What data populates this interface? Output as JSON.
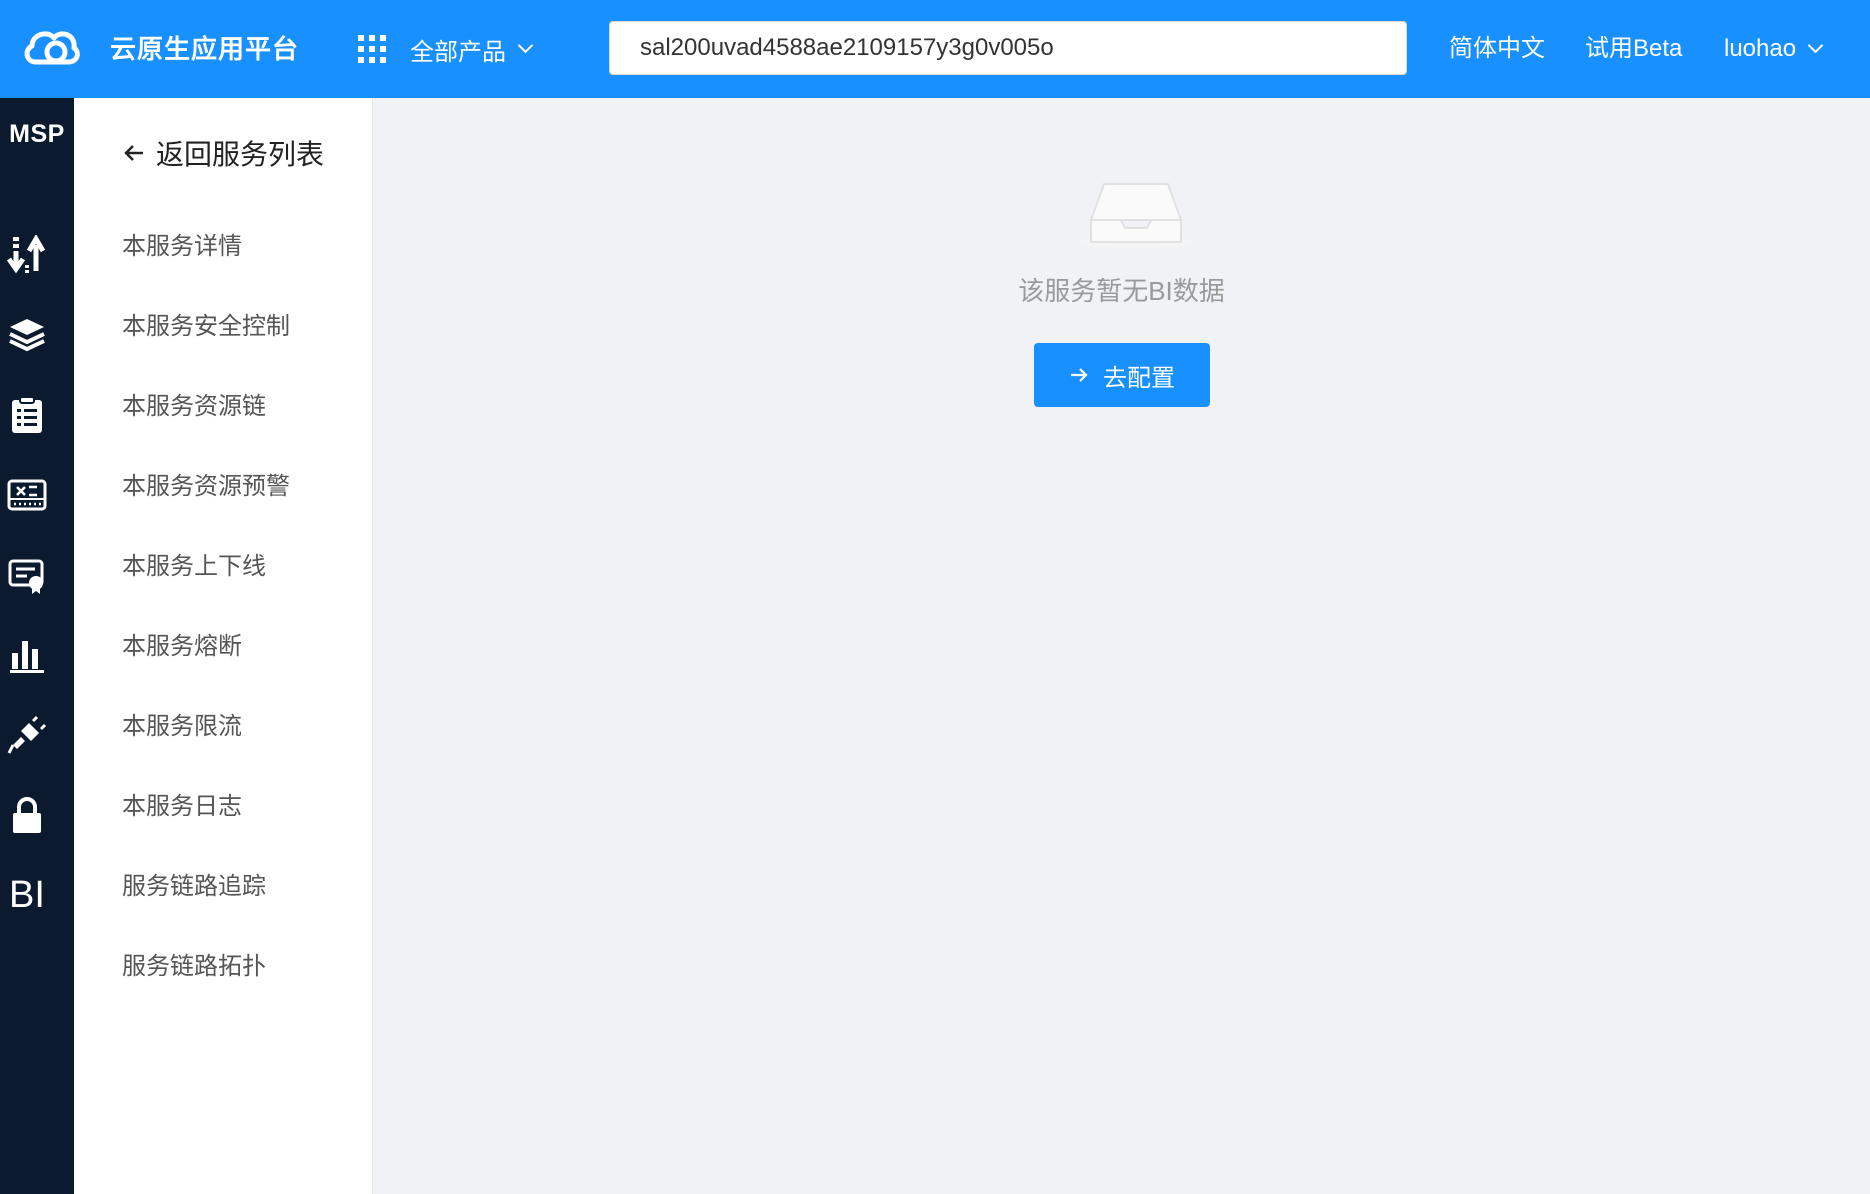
{
  "header": {
    "brand": "云原生应用平台",
    "products_label": "全部产品",
    "search_value": "sal200uvad4588ae2109157y3g0v005o",
    "language": "简体中文",
    "beta": "试用Beta",
    "user": "luohao"
  },
  "rail": {
    "title": "MSP",
    "icons": [
      "sort-arrows-icon",
      "layers-icon",
      "clipboard-list-icon",
      "switch-panel-icon",
      "certificate-icon",
      "bar-chart-icon",
      "plug-icon",
      "lock-icon",
      "bi-icon"
    ],
    "bi_label": "BI"
  },
  "sidebar": {
    "back_label": "返回服务列表",
    "items": [
      {
        "label": "本服务详情"
      },
      {
        "label": "本服务安全控制"
      },
      {
        "label": "本服务资源链"
      },
      {
        "label": "本服务资源预警"
      },
      {
        "label": "本服务上下线"
      },
      {
        "label": "本服务熔断"
      },
      {
        "label": "本服务限流"
      },
      {
        "label": "本服务日志"
      },
      {
        "label": "服务链路追踪"
      },
      {
        "label": "服务链路拓扑"
      }
    ]
  },
  "main": {
    "empty_text": "该服务暂无BI数据",
    "config_button": "去配置"
  },
  "colors": {
    "primary": "#1890ff",
    "rail_bg": "#0b1a2e",
    "content_bg": "#f0f2f5"
  }
}
